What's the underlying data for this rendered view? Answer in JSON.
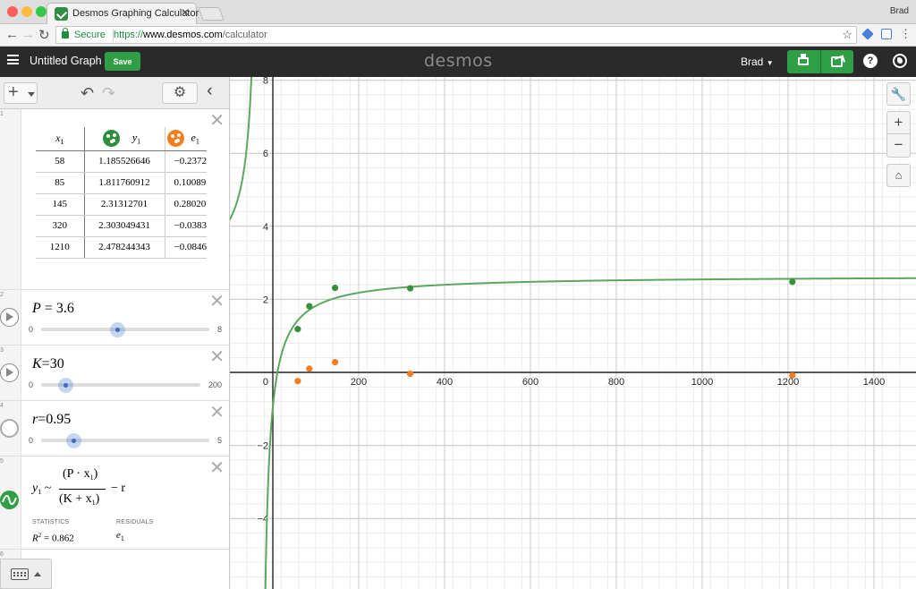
{
  "browser": {
    "tab_title": "Desmos Graphing Calculator",
    "profile_name": "Brad",
    "secure_label": "Secure",
    "url_scheme": "https://",
    "url_host": "www.desmos.com",
    "url_path": "/calculator",
    "colors": {
      "close": "#fc605b",
      "minimize": "#fdbc40",
      "maximize": "#34c84a"
    }
  },
  "header": {
    "graph_title": "Untitled Graph",
    "save_label": "Save",
    "logo": "desmos",
    "user": "Brad"
  },
  "expressions": {
    "table": {
      "index": "1",
      "col_x": "x",
      "col_x_sub": "1",
      "col_y": "y",
      "col_y_sub": "1",
      "col_e": "e",
      "col_e_sub": "1",
      "series_colors": {
        "y1": "#2d8e3c",
        "e1": "#f47d1f"
      },
      "rows": [
        {
          "x": "58",
          "y": "1.185526646",
          "e": "−0.2372"
        },
        {
          "x": "85",
          "y": "1.811760912",
          "e": "0.10089"
        },
        {
          "x": "145",
          "y": "2.31312701",
          "e": "0.28020"
        },
        {
          "x": "320",
          "y": "2.303049431",
          "e": "−0.0383"
        },
        {
          "x": "1210",
          "y": "2.478244343",
          "e": "−0.0846"
        }
      ]
    },
    "slider_p": {
      "index": "2",
      "var": "P",
      "op": "=",
      "value": "3.6",
      "min": "0",
      "max": "8",
      "fraction": 0.45
    },
    "slider_k": {
      "index": "3",
      "var": "K",
      "op": "=",
      "value": "30",
      "min": "0",
      "max": "200",
      "fraction": 0.15
    },
    "slider_r": {
      "index": "4",
      "var": "r",
      "op": "=",
      "value": "0.95",
      "min": "0",
      "max": "5",
      "fraction": 0.19
    },
    "regression": {
      "index": "5",
      "lhs": "y",
      "lhs_sub": "1",
      "tilde": "~",
      "numerator": "(P · x",
      "numerator_sub": "1",
      "numerator_close": ")",
      "denominator": "(K + x",
      "denominator_sub": "1",
      "denominator_close": ")",
      "tail": "− r",
      "stats_label": "STATISTICS",
      "stats_value": "R",
      "stats_sup": "2",
      "stats_rest": " = 0.862",
      "residuals_label": "RESIDUALS",
      "residuals_value": "e",
      "residuals_sub": "1"
    },
    "next_index": "6"
  },
  "graph": {
    "x_ticks": [
      "200",
      "400",
      "600",
      "800",
      "1000",
      "1200",
      "1400"
    ],
    "y_ticks": [
      "8",
      "6",
      "4",
      "2",
      "−2",
      "−4"
    ],
    "origin_label": "0",
    "curve_color": "#5aa85d",
    "point_color_y": "#3a8f3f",
    "point_color_e": "#f47d1f",
    "points_y": [
      [
        58,
        1.1855
      ],
      [
        85,
        1.8118
      ],
      [
        145,
        2.3131
      ],
      [
        320,
        2.303
      ],
      [
        1210,
        2.4782
      ]
    ],
    "points_e": [
      [
        58,
        -0.2372
      ],
      [
        85,
        0.1009
      ],
      [
        145,
        0.2802
      ],
      [
        320,
        -0.0383
      ],
      [
        1210,
        -0.0846
      ]
    ],
    "params": {
      "P": 3.6,
      "K": 30,
      "r": 0.95
    },
    "zoom_in": "+",
    "zoom_out": "−"
  }
}
